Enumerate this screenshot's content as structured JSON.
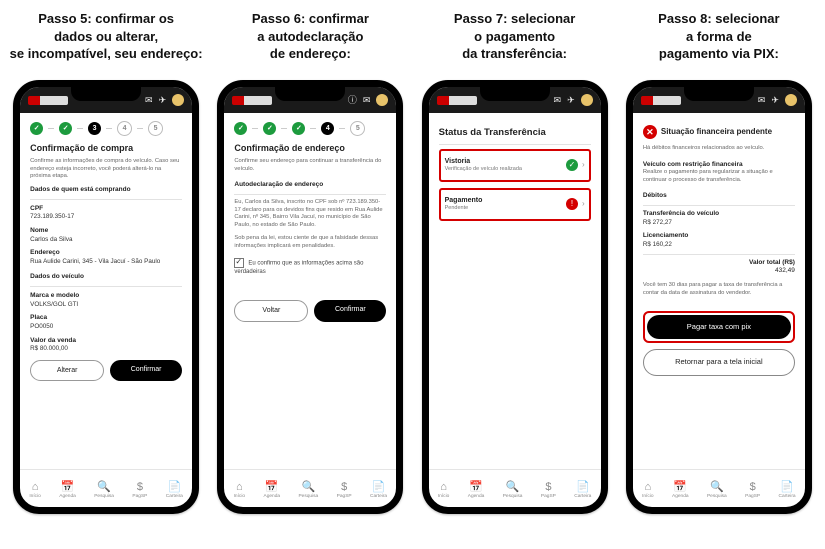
{
  "steps": [
    {
      "title_l1": "Passo 5: confirmar os",
      "title_l2": "dados ou alterar,",
      "title_l3": "se incompatível, seu endereço:"
    },
    {
      "title_l1": "Passo 6: confirmar",
      "title_l2": "a autodeclaração",
      "title_l3": "de endereço:"
    },
    {
      "title_l1": "Passo 7: selecionar",
      "title_l2": "o pagamento",
      "title_l3": "da transferência:"
    },
    {
      "title_l1": "Passo 8: selecionar",
      "title_l2": "a forma de",
      "title_l3": "pagamento via PIX:"
    }
  ],
  "nav": [
    {
      "icon": "⌂",
      "label": "Início"
    },
    {
      "icon": "📅",
      "label": "Agenda"
    },
    {
      "icon": "🔍",
      "label": "Pesquisa"
    },
    {
      "icon": "$",
      "label": "PagSP"
    },
    {
      "icon": "📄",
      "label": "Carteira"
    }
  ],
  "p5": {
    "stepper": [
      "done",
      "done",
      "active:3",
      "todo:4",
      "todo:5"
    ],
    "heading": "Confirmação de compra",
    "intro": "Confirme as informações de compra do veículo. Caso seu endereço esteja incorreto, você poderá alterá-lo na próxima etapa.",
    "sec1": "Dados de quem está comprando",
    "cpf_label": "CPF",
    "cpf_value": "723.189.350-17",
    "nome_label": "Nome",
    "nome_value": "Carlos da Silva",
    "endereco_label": "Endereço",
    "endereco_value": "Rua Aulide Carini, 345 - Vila Jacuí - São Paulo",
    "sec2": "Dados do veículo",
    "marca_label": "Marca e modelo",
    "marca_value": "VOLKS/GOL GTI",
    "placa_label": "Placa",
    "placa_value": "PO0050",
    "valor_label": "Valor da venda",
    "valor_value": "R$ 80.000,00",
    "btn_alter": "Alterar",
    "btn_conf": "Confirmar"
  },
  "p6": {
    "stepper": [
      "done",
      "done",
      "done",
      "active:4",
      "todo:5"
    ],
    "heading": "Confirmação de endereço",
    "intro": "Confirme seu endereço para continuar a transferência do veículo.",
    "sec": "Autodeclaração de endereço",
    "body1": "Eu, Carlos da Silva, inscrito no CPF sob nº 723.189.350-17 declaro para os devidos fins que resido em Rua Aulide Carini, nº 345, Bairro Vila Jacuí, no município de São Paulo, no estado de São Paulo.",
    "body2": "Sob pena da lei, estou ciente de que a falsidade dessas informações implicará em penalidades.",
    "check": "Eu confirmo que as informações acima são verdadeiras",
    "btn_back": "Voltar",
    "btn_conf": "Confirmar"
  },
  "p7": {
    "heading": "Status da Transferência",
    "r1_title": "Vistoria",
    "r1_sub": "Verificação de veículo realizada",
    "r2_title": "Pagamento",
    "r2_sub": "Pendente"
  },
  "p8": {
    "alert": "Situação financeira pendente",
    "line1": "Há débitos financeiros relacionados ao veículo.",
    "sec1": "Veículo com restrição financeira",
    "sec1_body": "Realize o pagamento para regularizar a situação e continuar o processo de transferência.",
    "debitos": "Débitos",
    "transf_label": "Transferência do veículo",
    "transf_value": "R$ 272,27",
    "lic_label": "Licenciamento",
    "lic_value": "R$ 160,22",
    "total_label": "Valor total (R$)",
    "total_value": "432,49",
    "note": "Você tem 30 dias para pagar a taxa de transferência a contar da data de assinatura do vendedor.",
    "btn_pay": "Pagar taxa com pix",
    "btn_return": "Retornar para a tela inicial"
  }
}
